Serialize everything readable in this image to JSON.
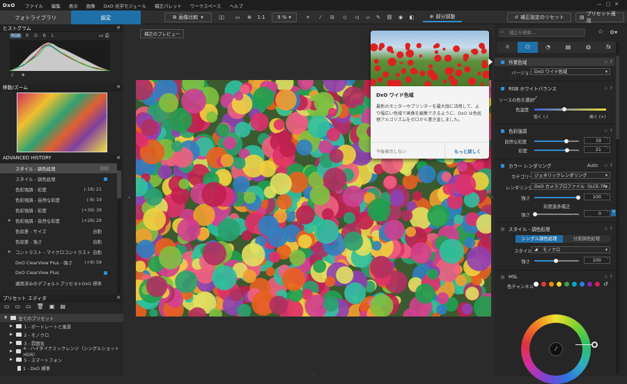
{
  "menubar": {
    "logo": "DxO",
    "items": [
      "ファイル",
      "編集",
      "表示",
      "画像",
      "DxO 光学モジュール",
      "補正パレット",
      "ワークスペース",
      "ヘルプ"
    ]
  },
  "tabs": {
    "library": "フォトライブラリ",
    "settings": "設定"
  },
  "toolbar": {
    "compare": "画像比較",
    "zoom_label": "1:1",
    "zoom_value": "9 %",
    "local": "部分調整",
    "reset": "補正設定のリセット",
    "apply_preset": "プリセット適用"
  },
  "histogram": {
    "title": "ヒストグラム",
    "channels": [
      "RGB",
      "R",
      "G",
      "B",
      "L"
    ],
    "selected": "RGB"
  },
  "navigator": {
    "title": "移動/ズーム"
  },
  "history": {
    "title": "ADVANCED HISTORY",
    "rows": [
      {
        "label": "スタイル - 調色処理",
        "val": "",
        "sel": true,
        "arrow": false
      },
      {
        "label": "スタイル - 調色処理",
        "val": "",
        "sel": false,
        "arrow": false,
        "blue": true
      },
      {
        "label": "色彩強調 - 彩度",
        "val": "(-18) 21",
        "sel": false,
        "arrow": false
      },
      {
        "label": "色彩強調 - 自然な彩度",
        "val": "(-8) 19",
        "sel": false,
        "arrow": false
      },
      {
        "label": "色彩強調 - 彩度",
        "val": "(+39) 39",
        "sel": false,
        "arrow": false
      },
      {
        "label": "色彩強調 - 自然な彩度",
        "val": "(+28) 28",
        "sel": false,
        "arrow": true
      },
      {
        "label": "色収差 - サイズ",
        "val": "自動",
        "sel": false,
        "arrow": false
      },
      {
        "label": "色収差 - 強さ",
        "val": "自動",
        "sel": false,
        "arrow": false
      },
      {
        "label": "コントラスト - マイクロコントラスト",
        "val": "自動",
        "sel": false,
        "arrow": true
      },
      {
        "label": "DxO ClearView Plus - 強さ",
        "val": "(+8) 58",
        "sel": false,
        "arrow": false
      },
      {
        "label": "DxO ClearView Plus",
        "val": "",
        "sel": false,
        "arrow": false,
        "blue": true
      },
      {
        "label": "適用済みのデフォルトプリセット",
        "val": "1 - DxO 標準",
        "sel": false,
        "arrow": false
      }
    ]
  },
  "preset_editor": {
    "title": "プリセット エディタ",
    "root": "全てのプリセット",
    "items": [
      "1 - ポートレートと風景",
      "2 - モノクロ",
      "3 - 雰囲気",
      "4 - ハイダイナミックレンジ（シングルショットHDR）",
      "5 - スマートフォン",
      "1 - DxO 標準"
    ]
  },
  "preview": {
    "label": "補正のプレビュー"
  },
  "tooltip": {
    "title": "DxO ワイド色域",
    "body": "最新のモニターやプリンターを最大限に活用して、より幅広い色域で画像を編集できるように、DxO は色処理アルゴリズムをゼロから書き直しました。",
    "dismiss": "今後表示しない",
    "more": "もっと詳しく"
  },
  "right": {
    "search_placeholder": "補正を検索…",
    "working_space": {
      "title": "作業色域",
      "version_label": "バージョン",
      "version_value": "DxO ワイド色域"
    },
    "wb": {
      "title": "RGB ホワイトバランス",
      "source": "ソースの色を選択",
      "temp": "色温度",
      "low": "低く (-)",
      "high": "高く (+)"
    },
    "color_accent": {
      "title": "色彩強調",
      "vibrancy_label": "自然な彩度",
      "vibrancy": "19",
      "saturation_label": "彩度",
      "saturation": "21",
      "vibrancy_pct": 0.72,
      "saturation_pct": 0.73
    },
    "color_rendering": {
      "title": "カラー レンダリング",
      "auto": "Auto",
      "category_label": "カテゴリー",
      "category": "ジェネリックレンダリング",
      "rendering_label": "レンダリング",
      "rendering": "DxO カメラプロファイル（ILCE-7R...",
      "strength_label": "強さ",
      "strength": "100",
      "oversat": "彩度過多補正",
      "oversat_strength_label": "強さ",
      "oversat_strength": "0"
    },
    "style": {
      "title": "スタイル - 調色処理",
      "tab1": "シングル調色処理",
      "tab2": "分割調色処理",
      "style_label": "スタイル",
      "style_value": "モノクロ",
      "strength_label": "強さ",
      "strength": "100"
    },
    "hsl": {
      "title": "HSL",
      "channel_label": "色チャンネル"
    }
  },
  "colors": {
    "accent": "#2e8fd6",
    "tab_active": "#1f6fa8",
    "hsl_dots": [
      "#ffffff",
      "#e53935",
      "#fb8c00",
      "#fdd835",
      "#43a047",
      "#00acc1",
      "#1e88e5",
      "#8e24aa",
      "#d81b60"
    ]
  }
}
